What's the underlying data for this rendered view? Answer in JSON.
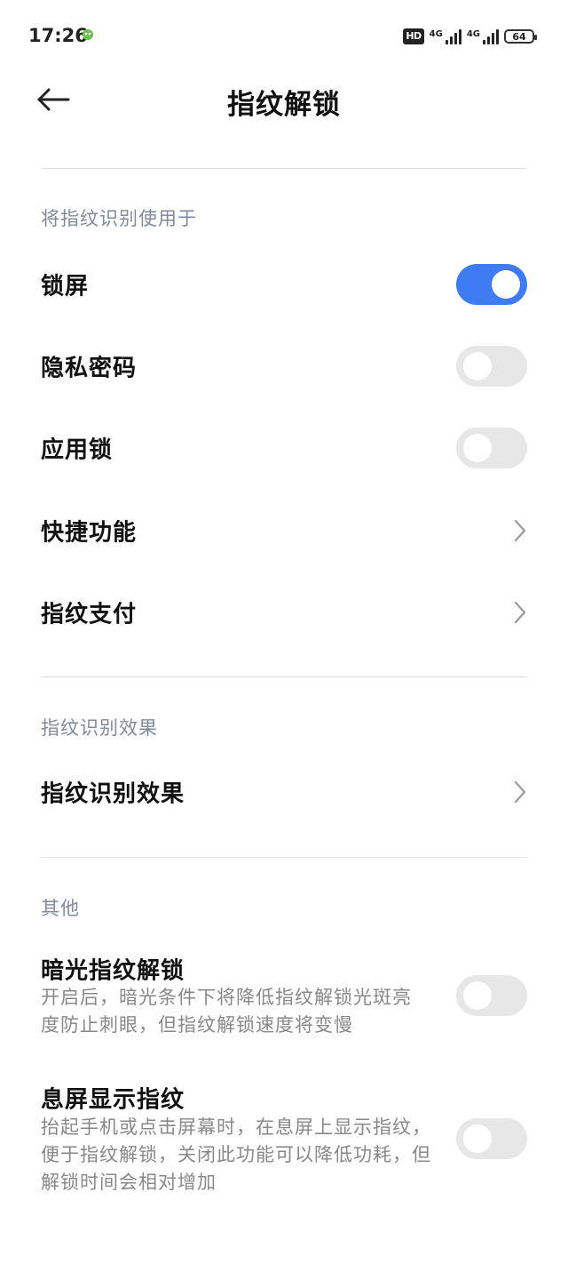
{
  "status_bar": {
    "time": "17:26",
    "hd_badge": "HD",
    "network_1": "4G",
    "network_2": "4G",
    "battery": "64"
  },
  "header": {
    "title": "指纹解锁",
    "back_icon": "arrow-left-icon"
  },
  "sections": {
    "use_for": {
      "label": "将指纹识别使用于",
      "items": [
        {
          "label": "锁屏",
          "control": "toggle",
          "on": true
        },
        {
          "label": "隐私密码",
          "control": "toggle",
          "on": false
        },
        {
          "label": "应用锁",
          "control": "toggle",
          "on": false
        },
        {
          "label": "快捷功能",
          "control": "chevron"
        },
        {
          "label": "指纹支付",
          "control": "chevron"
        }
      ]
    },
    "effect": {
      "label": "指纹识别效果",
      "items": [
        {
          "label": "指纹识别效果",
          "control": "chevron"
        }
      ]
    },
    "other": {
      "label": "其他",
      "items": [
        {
          "label": "暗光指纹解锁",
          "desc_lines": [
            "开启后，暗光条件下将降低指纹解锁光斑亮",
            "度防止刺眼，但指纹解锁速度将变慢"
          ],
          "control": "toggle",
          "on": false
        },
        {
          "label": "息屏显示指纹",
          "desc_lines": [
            "抬起手机或点击屏幕时，在息屏上显示指纹，",
            "便于指纹解锁，关闭此功能可以降低功耗，但",
            "解锁时间会相对增加"
          ],
          "control": "toggle",
          "on": false
        }
      ]
    }
  },
  "colors": {
    "accent": "#3f7cf4",
    "toggle_off": "#e7e7e7",
    "section_label": "#7f8a9c",
    "subtext": "#888888"
  }
}
